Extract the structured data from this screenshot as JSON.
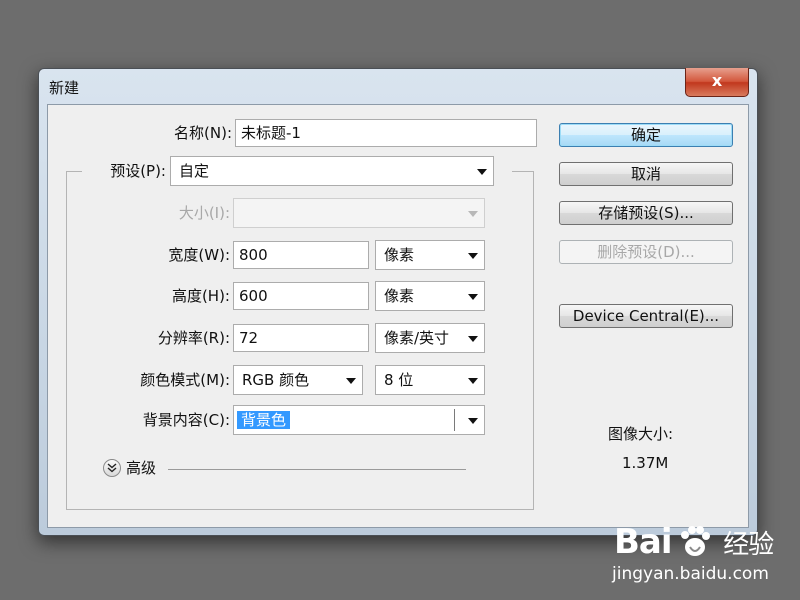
{
  "dialog": {
    "title": "新建",
    "close_label": "x"
  },
  "form": {
    "name": {
      "label": "名称(N):",
      "value": "未标题-1"
    },
    "preset": {
      "label": "预设(P):",
      "value": "自定"
    },
    "size": {
      "label": "大小(I):",
      "value": ""
    },
    "width": {
      "label": "宽度(W):",
      "value": "800",
      "unit": "像素"
    },
    "height": {
      "label": "高度(H):",
      "value": "600",
      "unit": "像素"
    },
    "resolution": {
      "label": "分辨率(R):",
      "value": "72",
      "unit": "像素/英寸"
    },
    "color_mode": {
      "label": "颜色模式(M):",
      "value": "RGB 颜色",
      "depth": "8 位"
    },
    "background": {
      "label": "背景内容(C):",
      "value": "背景色"
    },
    "advanced_label": "高级"
  },
  "buttons": {
    "ok": "确定",
    "cancel": "取消",
    "save_preset": "存储预设(S)...",
    "delete_preset": "删除预设(D)...",
    "device_central": "Device Central(E)..."
  },
  "image_size": {
    "label": "图像大小:",
    "value": "1.37M"
  },
  "watermark": {
    "brand": "Bai",
    "brand_cn": "经验",
    "url": "jingyan.baidu.com"
  },
  "colors": {
    "selection": "#3399ff",
    "close_button": "#c1371d",
    "default_button_border": "#3c7fb1"
  },
  "icons": [
    "close-icon",
    "dropdown-arrow-icon",
    "expand-chevron-icon",
    "paw-icon"
  ]
}
